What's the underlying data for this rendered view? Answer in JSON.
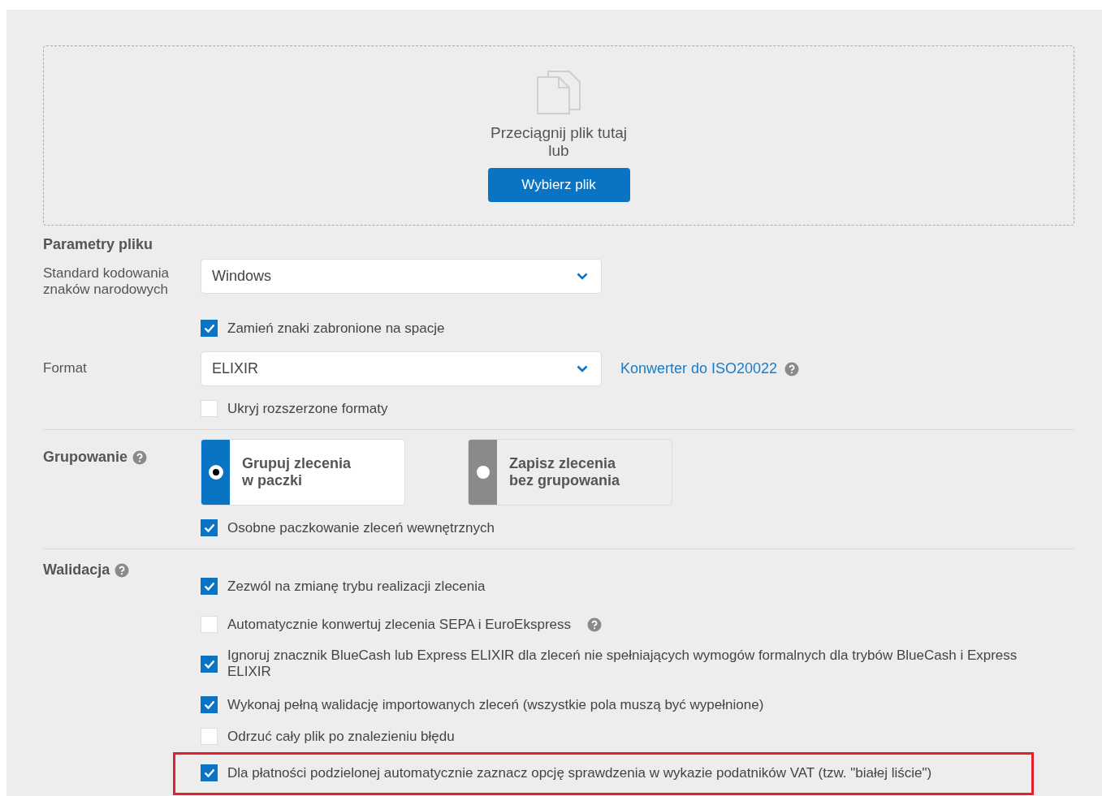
{
  "dropzone": {
    "text": "Przeciągnij plik tutaj",
    "or_text": "lub",
    "button": "Wybierz plik"
  },
  "file_params": {
    "title": "Parametry pliku",
    "encoding": {
      "label": "Standard kodowania znaków narodowych",
      "value": "Windows"
    },
    "encoding_options": [
      {
        "label": "Zamień znaki zabronione na spacje",
        "checked": true
      }
    ],
    "format": {
      "label": "Format",
      "value": "ELIXIR",
      "link": "Konwerter do ISO20022"
    },
    "format_options": [
      {
        "label": "Ukryj rozszerzone formaty",
        "checked": false
      }
    ]
  },
  "grouping": {
    "label": "Grupowanie",
    "choices": [
      {
        "label": "Grupuj zlecenia\nw paczki",
        "selected": true
      },
      {
        "label": "Zapisz zlecenia\nbez grupowania",
        "selected": false
      }
    ],
    "options": [
      {
        "label": "Osobne paczkowanie zleceń wewnętrznych",
        "checked": true
      }
    ]
  },
  "validation": {
    "label": "Walidacja",
    "options": [
      {
        "label": "Zezwól na zmianę trybu realizacji zlecenia",
        "checked": true,
        "help": false,
        "highlighted": false
      },
      {
        "label": "Automatycznie konwertuj zlecenia SEPA i EuroEkspress",
        "checked": false,
        "help": true,
        "highlighted": false
      },
      {
        "label": "Ignoruj znacznik BlueCash lub Express ELIXIR dla zleceń nie spełniających wymogów formalnych dla trybów BlueCash i Express ELIXIR",
        "checked": true,
        "help": false,
        "highlighted": false
      },
      {
        "label": "Wykonaj pełną walidację importowanych zleceń (wszystkie pola muszą być wypełnione)",
        "checked": true,
        "help": false,
        "highlighted": false
      },
      {
        "label": "Odrzuć cały plik po znalezieniu błędu",
        "checked": false,
        "help": false,
        "highlighted": false
      },
      {
        "label": "Dla płatności podzielonej automatycznie zaznacz opcję sprawdzenia w wykazie podatników VAT (tzw. \"białej liście\")",
        "checked": true,
        "help": false,
        "highlighted": true
      }
    ]
  }
}
